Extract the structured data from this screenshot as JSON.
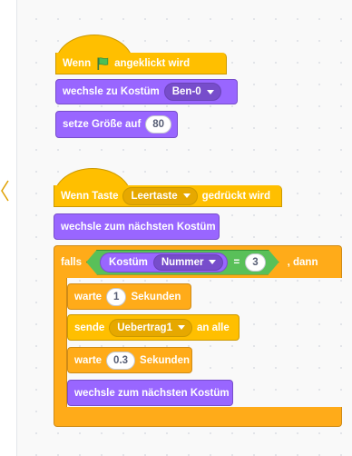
{
  "script1": {
    "hat": {
      "prefix": "Wenn",
      "icon": "green-flag-icon",
      "suffix": "angeklickt wird"
    },
    "costume_block": {
      "label": "wechsle zu Kostüm",
      "value": "Ben-0"
    },
    "size_block": {
      "label": "setze Größe auf",
      "value": "80"
    }
  },
  "script2": {
    "hat": {
      "prefix": "Wenn Taste",
      "key": "Leertaste",
      "suffix": "gedrückt wird"
    },
    "next_costume": {
      "label": "wechsle zum nächsten Kostüm"
    },
    "if_block": {
      "prefix": "falls",
      "condition": {
        "reporter_label": "Kostüm",
        "reporter_option": "Nummer",
        "operator": "=",
        "value": "3"
      },
      "suffix": ", dann"
    },
    "wait1": {
      "prefix": "warte",
      "value": "1",
      "suffix": "Sekunden"
    },
    "broadcast": {
      "prefix": "sende",
      "message": "Uebertrag1",
      "suffix": "an alle"
    },
    "wait2": {
      "prefix": "warte",
      "value": "0.3",
      "suffix": "Sekunden"
    },
    "next_costume_inner": {
      "label": "wechsle zum nächsten Kostüm"
    }
  },
  "colors": {
    "events": "#ffbf00",
    "looks": "#9966ff",
    "control": "#ffab19",
    "operators": "#59c059",
    "workspace": "#f9f9f9"
  }
}
